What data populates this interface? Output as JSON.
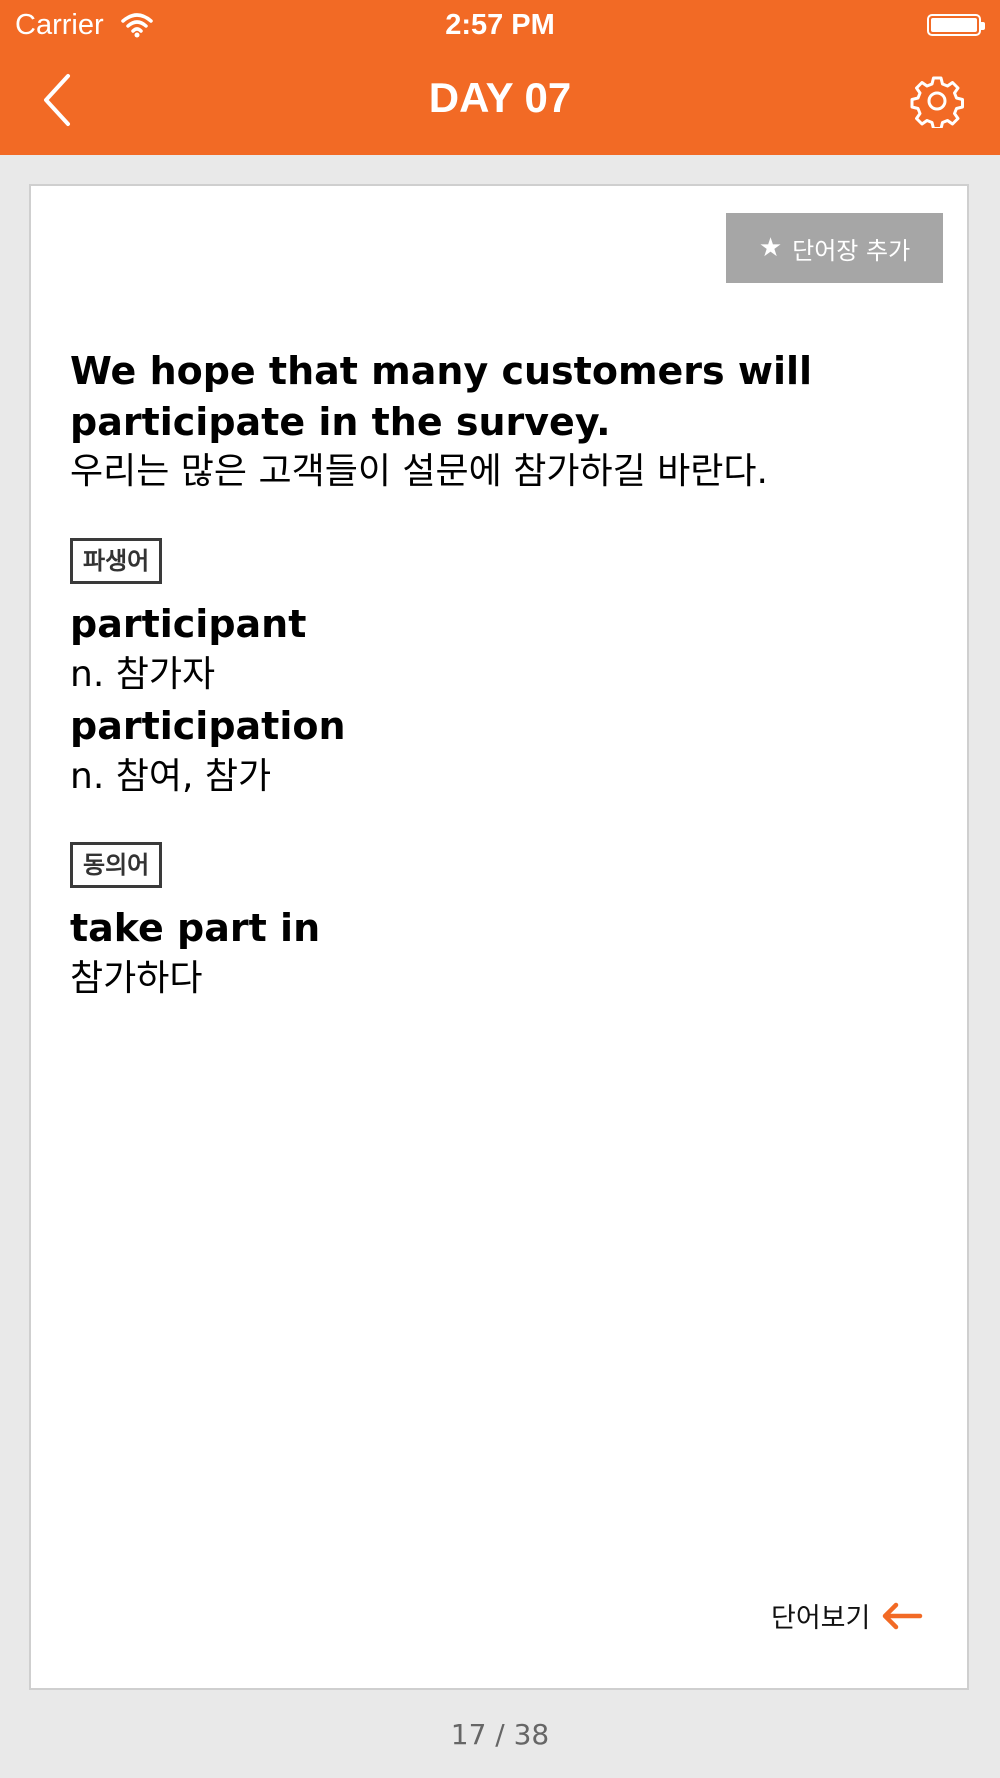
{
  "status_bar": {
    "carrier": "Carrier",
    "time": "2:57 PM"
  },
  "header": {
    "title": "DAY 07",
    "back_icon": "chevron-left-icon",
    "settings_icon": "gear-icon"
  },
  "card": {
    "add_button_label": "단어장 추가",
    "sentence_en": "We hope that many customers will participate in the survey.",
    "sentence_ko": "우리는 많은 고객들이 설문에 참가하길 바란다.",
    "derivatives": {
      "label": "파생어",
      "items": [
        {
          "word": "participant",
          "meaning": "n. 참가자"
        },
        {
          "word": "participation",
          "meaning": "n. 참여, 참가"
        }
      ]
    },
    "synonyms": {
      "label": "동의어",
      "items": [
        {
          "word": "take part in",
          "meaning": "참가하다"
        }
      ]
    },
    "view_words_label": "단어보기"
  },
  "pagination": {
    "text": "17 / 38"
  },
  "colors": {
    "accent": "#f26a25",
    "button_gray": "#a6a6a6"
  }
}
